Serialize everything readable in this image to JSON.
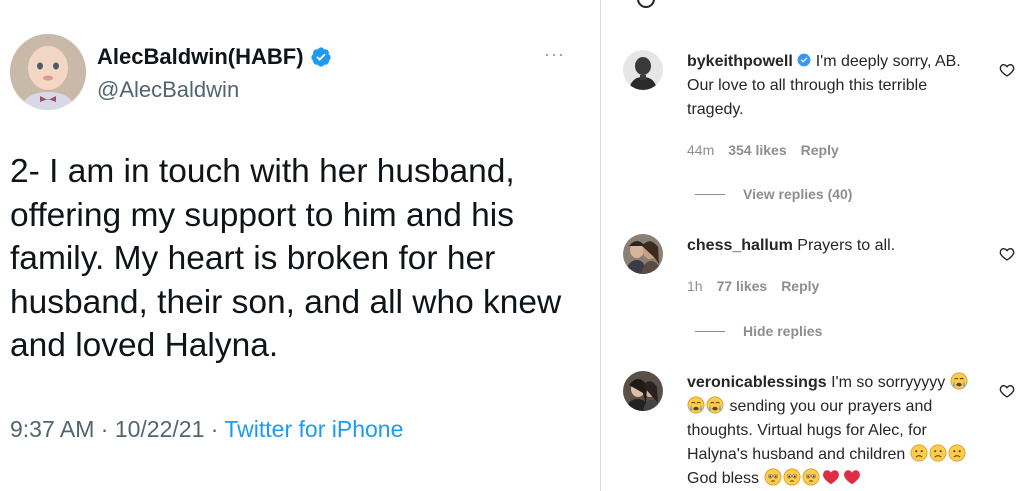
{
  "tweet": {
    "name": "AlecBaldwin(HABF)",
    "handle": "@AlecBaldwin",
    "more": "···",
    "text": "2- I am in touch with her husband, offering my support to him and his family. My heart is broken for her husband, their son, and all who knew and loved Halyna.",
    "time_date": "9:37 AM · 10/22/21 · ",
    "source": "Twitter for iPhone",
    "colors": {
      "link": "#1d9bf0",
      "verified": "#1d9bf0",
      "text": "#0f1419",
      "secondary": "#536471"
    }
  },
  "comments": [
    {
      "user": "bykeithpowell",
      "verified": true,
      "text": "I'm deeply sorry, AB. Our love to all through this terrible tragedy.",
      "time": "44m",
      "likes": "354 likes",
      "reply": "Reply",
      "replies_toggle": "View replies (40)"
    },
    {
      "user": "chess_hallum",
      "text": "Prayers to all.",
      "time": "1h",
      "likes": "77 likes",
      "reply": "Reply",
      "replies_toggle": "Hide replies"
    },
    {
      "user": "veronicablessings",
      "text_a": "I'm so sorryyyyy",
      "text_b": "sending you our prayers and thoughts. Virtual hugs for Alec, for Halyna's husband and children",
      "text_c": "God bless",
      "emojis": [
        "crying-face",
        "crying-face",
        "crying-face",
        "sad-face",
        "sad-face",
        "sad-face",
        "pleading-face",
        "pleading-face",
        "pleading-face",
        "red-heart",
        "red-heart"
      ]
    }
  ],
  "icons": {
    "verified": "verified-badge-icon",
    "heart": "heart-outline-icon",
    "more": "more-dots-icon"
  }
}
